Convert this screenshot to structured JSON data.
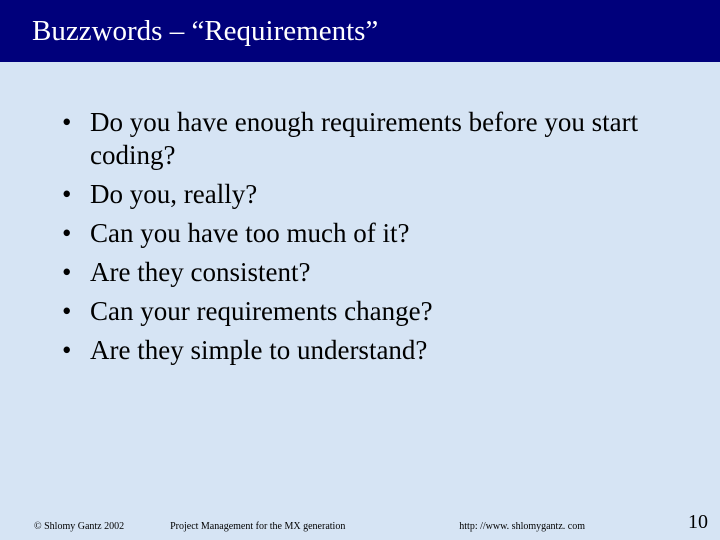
{
  "title": "Buzzwords – “Requirements”",
  "bullets": [
    "Do you have enough requirements before you start coding?",
    "Do you, really?",
    "Can you have too much of it?",
    "Are they consistent?",
    "Can your requirements change?",
    "Are they simple to understand?"
  ],
  "footer": {
    "copyright": "© Shlomy Gantz 2002",
    "center": "Project Management for the MX generation",
    "url": "http: //www. shlomygantz. com",
    "page_number": "10"
  }
}
